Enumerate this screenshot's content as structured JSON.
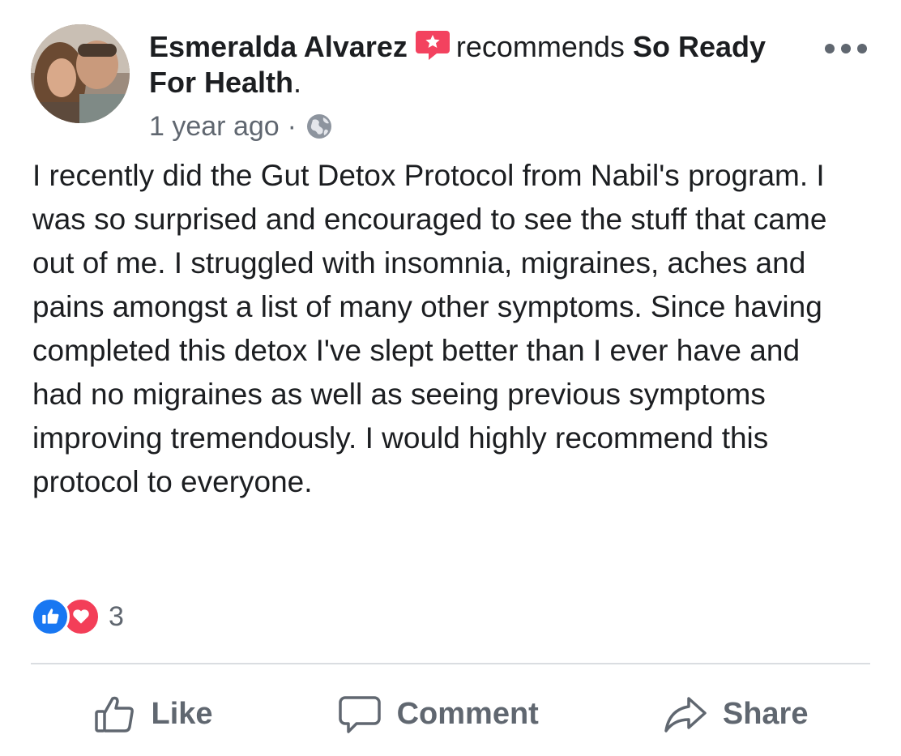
{
  "post": {
    "author": "Esmeralda Alvarez",
    "verb": "recommends",
    "page_name": "So Ready For Health",
    "page_suffix": ".",
    "timestamp": "1 year ago",
    "separator": "·",
    "privacy_icon": "globe-icon",
    "body": "I recently did the Gut Detox Protocol from Nabil's program.  I was so surprised and encouraged to see the stuff that came out of me.  I struggled with insomnia, migraines, aches and pains amongst a list of many other symptoms.  Since having completed this detox I've slept better than I ever have and had no migraines as well as seeing previous symptoms improving tremendously.  I would highly recommend this protocol to everyone.",
    "more_icon": "more-options-icon"
  },
  "reactions": {
    "types": [
      "like",
      "love"
    ],
    "count": "3"
  },
  "actions": {
    "like": "Like",
    "comment": "Comment",
    "share": "Share"
  },
  "colors": {
    "like_blue": "#1877f2",
    "love_red": "#f33e58",
    "recommend_red": "#f3425f",
    "secondary_text": "#606770",
    "divider": "#dadde1"
  }
}
